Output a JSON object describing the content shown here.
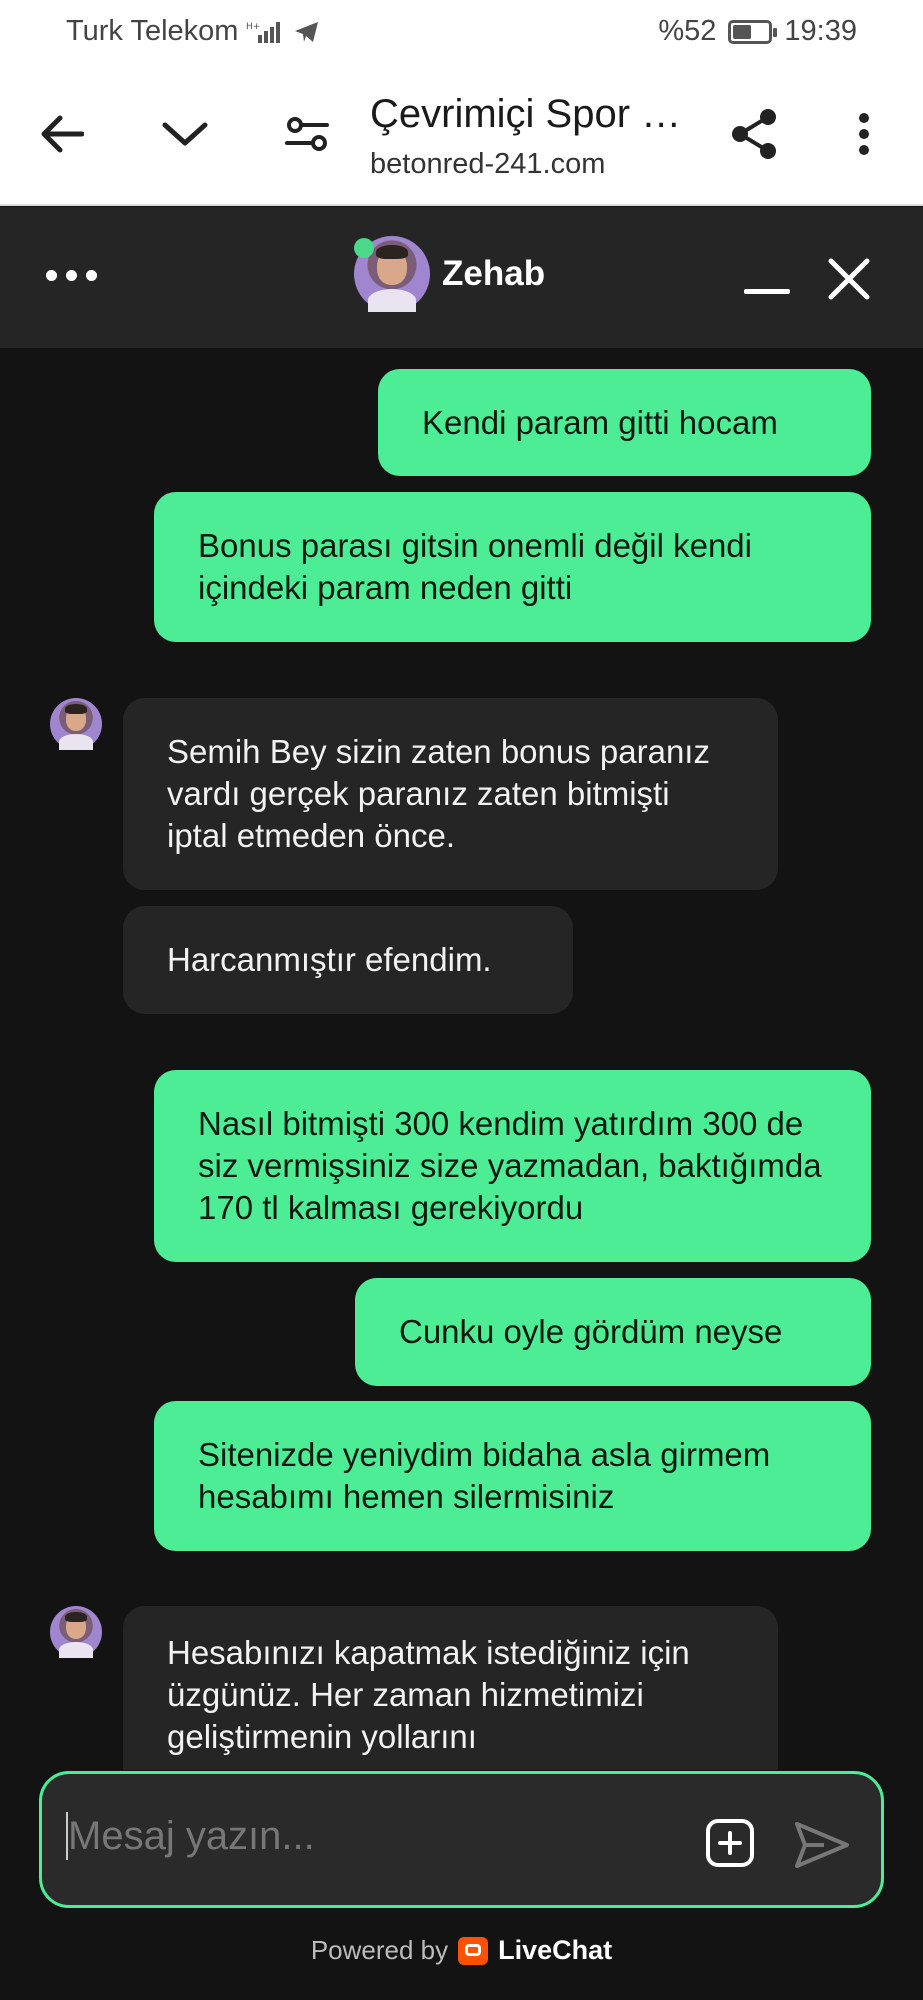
{
  "status_bar": {
    "carrier": "Turk Telekom",
    "battery": "%52",
    "battery_level": 0.52,
    "time": "19:39"
  },
  "browser": {
    "title": "Çevrimiçi Spor …",
    "url": "betonred-241.com",
    "icons": [
      "back-arrow-icon",
      "chevron-down-icon",
      "site-settings-icon",
      "share-icon",
      "more-vert-icon"
    ]
  },
  "chat": {
    "agent_name": "Zehab",
    "online_color": "#4bd88b",
    "accent_color": "#4ded95",
    "messages": [
      {
        "from": "user",
        "text": "Kendi param gitti hocam"
      },
      {
        "from": "user",
        "text": "Bonus parası gitsin onemli değil kendi içindeki param neden gitti"
      },
      {
        "from": "agent",
        "text": "Semih Bey sizin zaten bonus paranız vardı gerçek paranız zaten bitmişti iptal etmeden önce."
      },
      {
        "from": "agent",
        "text": "Harcanmıştır efendim."
      },
      {
        "from": "user",
        "text": "Nasıl bitmişti 300 kendim yatırdım 300 de siz vermişsiniz size yazmadan, baktığımda 170 tl kalması gerekiyordu"
      },
      {
        "from": "user",
        "text": "Cunku oyle gördüm neyse"
      },
      {
        "from": "user",
        "text": "Sitenizde yeniydim bidaha asla girmem hesabımı hemen silermisiniz"
      },
      {
        "from": "agent",
        "text": "Hesabınızı kapatmak istediğiniz için üzgünüz. Her zaman hizmetimizi geliştirmenin yollarını"
      }
    ]
  },
  "composer": {
    "placeholder": "Mesaj yazın..."
  },
  "footer": {
    "powered_by": "Powered by",
    "brand": "LiveChat"
  }
}
